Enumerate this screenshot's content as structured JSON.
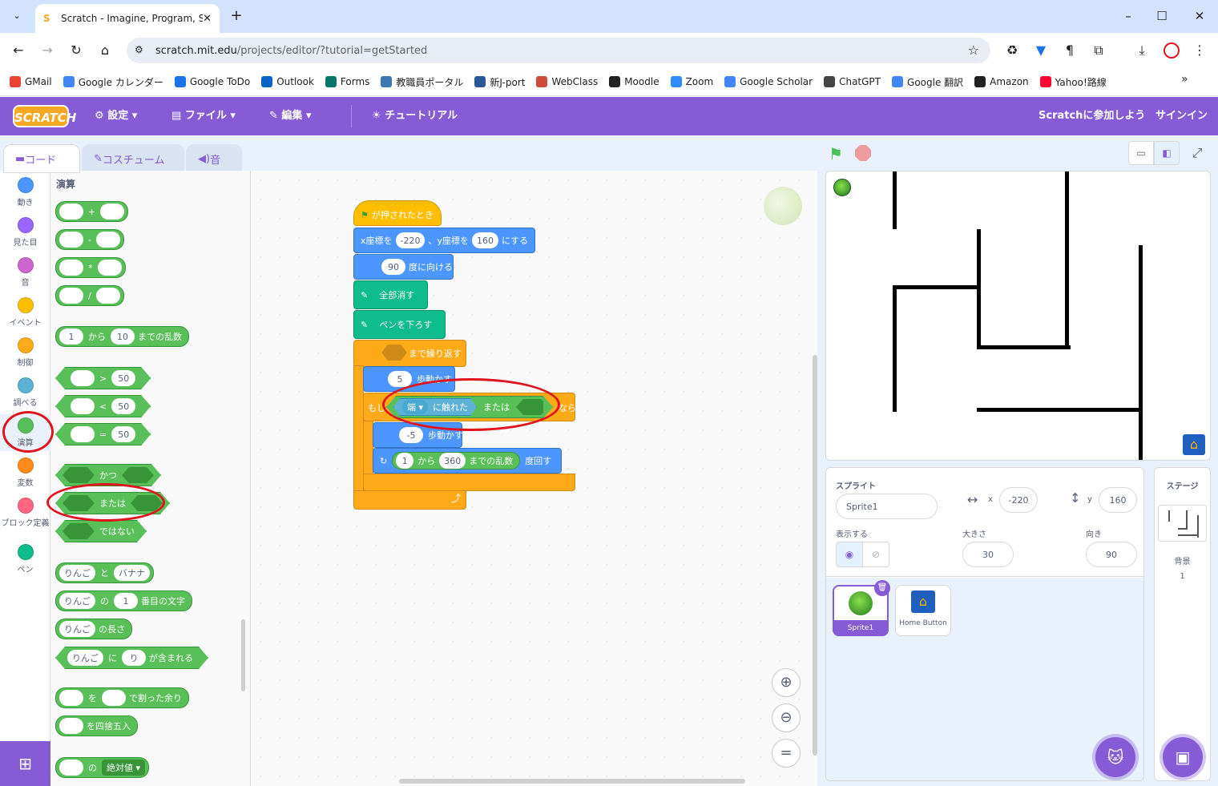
{
  "browser": {
    "tab_title": "Scratch - Imagine, Program, Sh",
    "url_host": "scratch.mit.edu",
    "url_path": "/projects/editor/?tutorial=getStarted",
    "bookmarks": [
      {
        "label": "GMail",
        "color": "#ea4335"
      },
      {
        "label": "Google カレンダー",
        "color": "#4285f4"
      },
      {
        "label": "Google ToDo",
        "color": "#1a73e8"
      },
      {
        "label": "Outlook",
        "color": "#0a64c8"
      },
      {
        "label": "Forms",
        "color": "#077568"
      },
      {
        "label": "教職員ポータル",
        "color": "#3c78b4"
      },
      {
        "label": "新J-port",
        "color": "#2b579a"
      },
      {
        "label": "WebClass",
        "color": "#d04a3c"
      },
      {
        "label": "Moodle",
        "color": "#222222"
      },
      {
        "label": "Zoom",
        "color": "#2d8cff"
      },
      {
        "label": "Google Scholar",
        "color": "#4285f4"
      },
      {
        "label": "ChatGPT",
        "color": "#444444"
      },
      {
        "label": "Google 翻訳",
        "color": "#4285f4"
      },
      {
        "label": "Amazon",
        "color": "#222222"
      },
      {
        "label": "Yahoo!路線",
        "color": "#ff0033"
      }
    ]
  },
  "menu": {
    "logo": "SCRATCH",
    "settings": "設定",
    "file": "ファイル",
    "edit": "編集",
    "tutorial": "チュートリアル",
    "join": "Scratchに参加しよう",
    "signin": "サインイン"
  },
  "tabs": {
    "code": "コード",
    "costume": "コスチューム",
    "sound": "音"
  },
  "categories": [
    {
      "label": "動き",
      "color": "#4c97ff"
    },
    {
      "label": "見た目",
      "color": "#9966ff"
    },
    {
      "label": "音",
      "color": "#cf63cf"
    },
    {
      "label": "イベント",
      "color": "#ffbf00"
    },
    {
      "label": "制御",
      "color": "#ffab19"
    },
    {
      "label": "調べる",
      "color": "#5cb1d6"
    },
    {
      "label": "演算",
      "color": "#59c059"
    },
    {
      "label": "変数",
      "color": "#ff8c1a"
    },
    {
      "label": "ブロック定義",
      "color": "#ff6680"
    },
    {
      "label": "ペン",
      "color": "#0fbd8c"
    }
  ],
  "palette": {
    "heading": "演算",
    "plus": "+",
    "minus": "-",
    "times": "*",
    "divide": "/",
    "random_from": "1",
    "random_kara": "から",
    "random_to": "10",
    "random_label": "までの乱数",
    "gt": ">",
    "lt": "<",
    "eq": "=",
    "fifty": "50",
    "and": "かつ",
    "or": "または",
    "not": "ではない",
    "apple": "りんご",
    "to": "と",
    "banana": "バナナ",
    "no": "の",
    "one": "1",
    "nth_char": "番目の文字",
    "length": "の長さ",
    "ni": "に",
    "ri": "り",
    "contains": "が含まれる",
    "wo": "を",
    "mod": "で割った余り",
    "round": "を四捨五入",
    "abs": "絶対値"
  },
  "script": {
    "hat": "が押されたとき",
    "goto_x_label": "x座標を",
    "goto_x": "-220",
    "goto_y_label": "、y座標を",
    "goto_y": "160",
    "goto_end": "にする",
    "dir_val": "90",
    "dir_label": "度に向ける",
    "clear": "全部消す",
    "pendown": "ペンを下ろす",
    "until": "まで繰り返す",
    "move1_val": "5",
    "move_label": "歩動かす",
    "if_label": "もし",
    "edge": "端",
    "touching": "に触れた",
    "or": "または",
    "then": "なら",
    "move2_val": "-5",
    "turn_from": "1",
    "kara": "から",
    "turn_to": "360",
    "rand": "までの乱数",
    "turn_label": "度回す"
  },
  "sprite_info": {
    "sprite_label": "スプライト",
    "name": "Sprite1",
    "x_label": "x",
    "x": "-220",
    "y_label": "y",
    "y": "160",
    "show_label": "表示する",
    "size_label": "大きさ",
    "size": "30",
    "dir_label": "向き",
    "direction": "90"
  },
  "sprites": [
    {
      "name": "Sprite1"
    },
    {
      "name": "Home Button"
    }
  ],
  "stage_pane": {
    "label": "ステージ",
    "backdrop_label": "背景",
    "backdrop_count": "1"
  }
}
